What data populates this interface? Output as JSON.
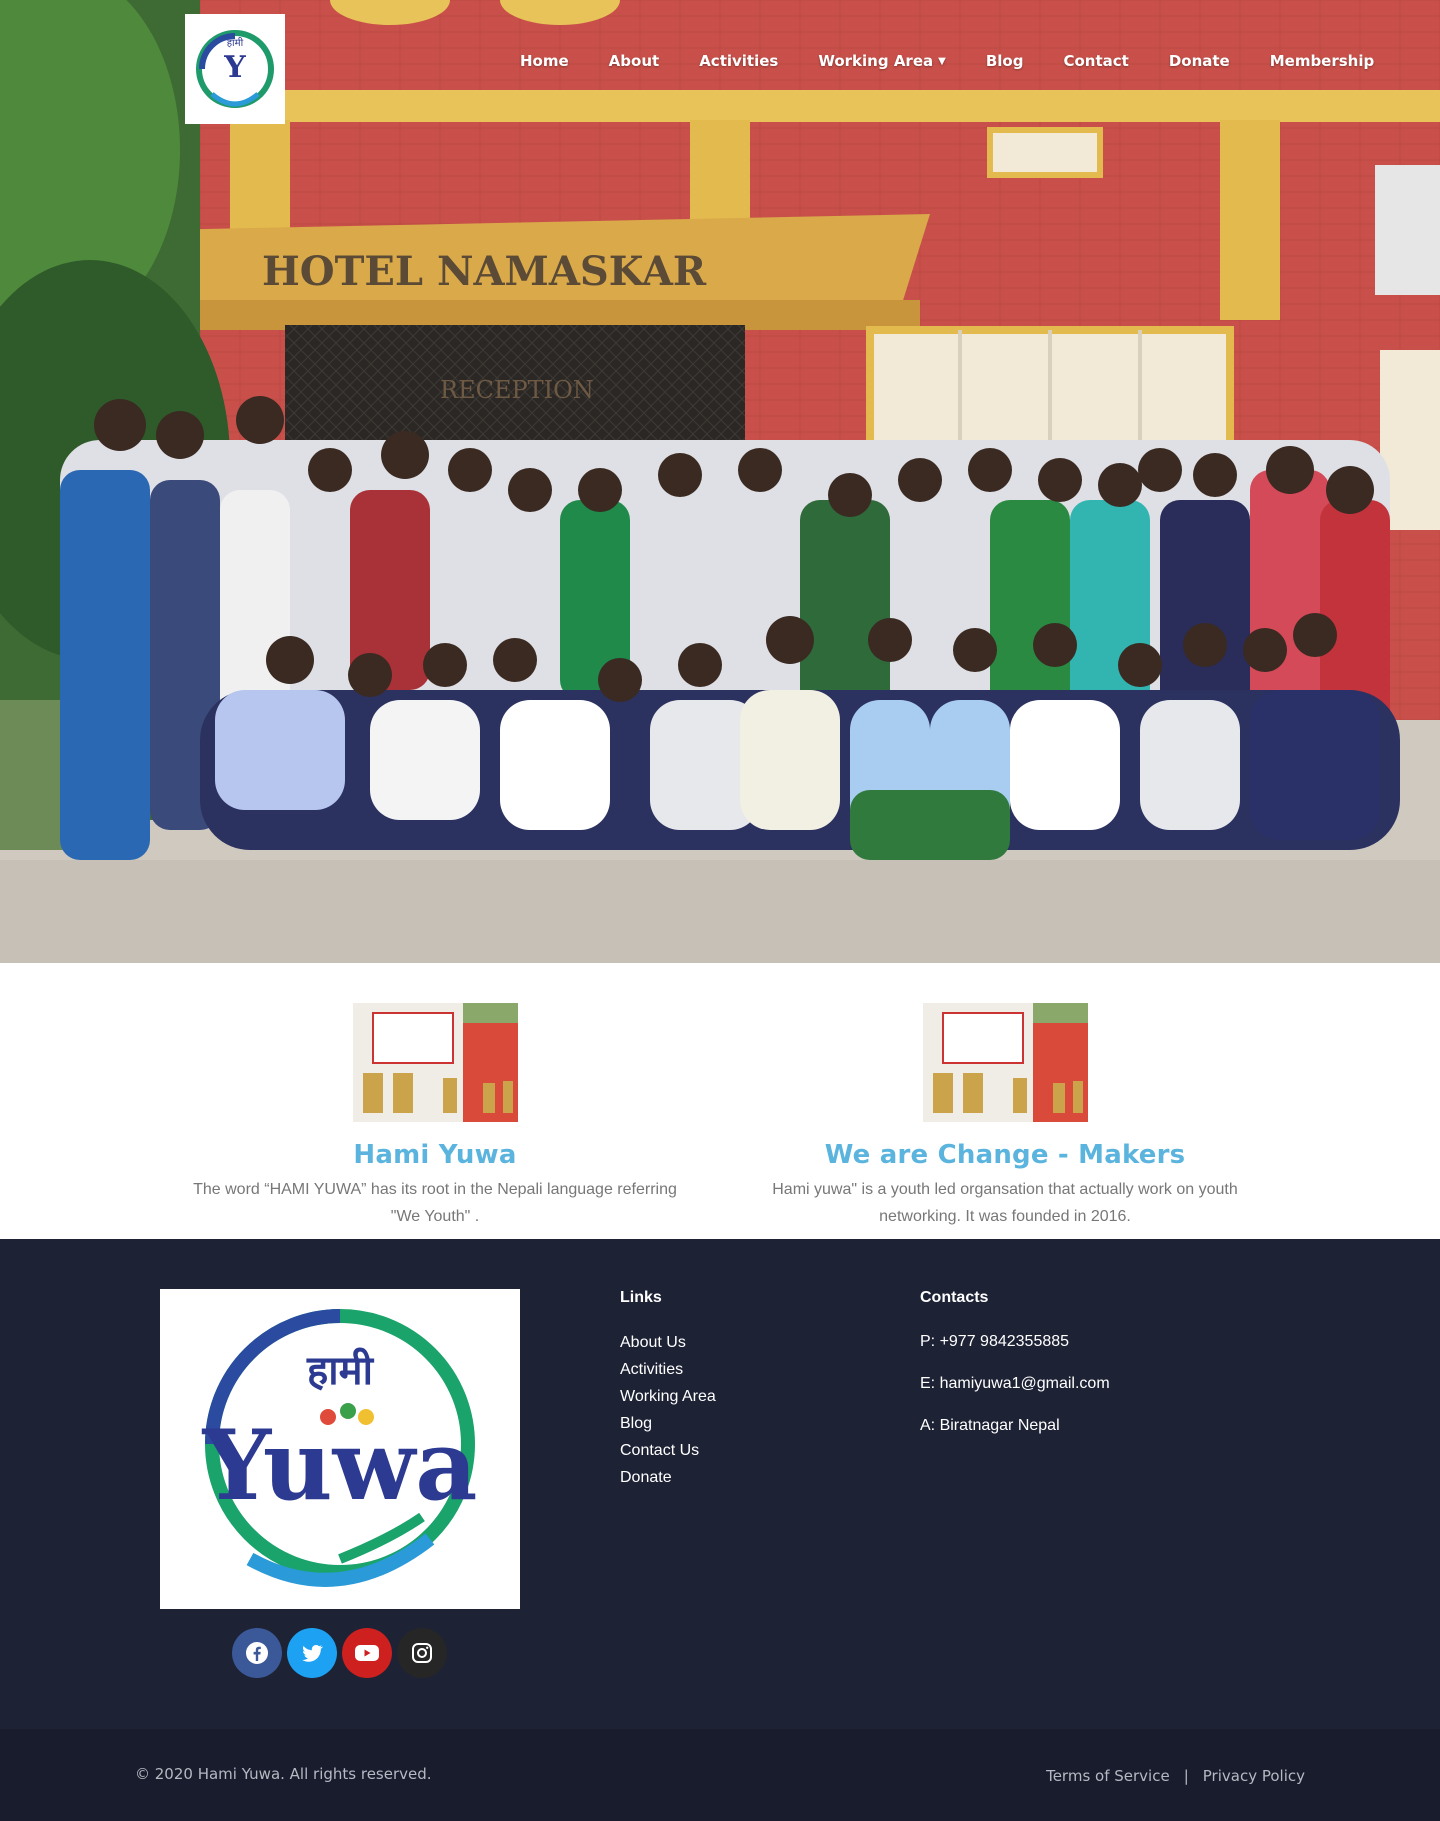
{
  "brand": {
    "logo_top": "हामी",
    "logo_main": "Yuwa"
  },
  "nav": {
    "items": [
      {
        "label": "Home"
      },
      {
        "label": "About"
      },
      {
        "label": "Activities"
      },
      {
        "label": "Working Area",
        "has_dropdown": true
      },
      {
        "label": "Blog"
      },
      {
        "label": "Contact"
      },
      {
        "label": "Donate"
      },
      {
        "label": "Membership"
      }
    ]
  },
  "hero": {
    "signboard": "HOTEL NAMASKAR",
    "door_sign": "RECEPTION"
  },
  "features": [
    {
      "title": "Hami Yuwa",
      "text": "The word “HAMI YUWA” has its root in the Nepali language referring \"We Youth\" ."
    },
    {
      "title": "We are Change - Makers",
      "text": "Hami yuwa\" is a youth led organsation that actually work on youth networking. It was founded in 2016."
    }
  ],
  "footer": {
    "links_title": "Links",
    "links": [
      "About Us",
      "Activities",
      "Working Area",
      "Blog",
      "Contact Us",
      "Donate"
    ],
    "contacts_title": "Contacts",
    "contacts": [
      "P: +977 9842355885",
      "E: hamiyuwa1@gmail.com",
      "A: Biratnagar Nepal"
    ],
    "social": [
      {
        "name": "facebook-icon",
        "color": "#3b5998"
      },
      {
        "name": "twitter-icon",
        "color": "#1da1f2"
      },
      {
        "name": "youtube-icon",
        "color": "#cd201f"
      },
      {
        "name": "instagram-icon",
        "color": "#262626"
      }
    ]
  },
  "bottom": {
    "copyright": "© 2020 Hami Yuwa. All rights reserved.",
    "terms": "Terms of Service",
    "separator": "|",
    "privacy": "Privacy Policy"
  },
  "colors": {
    "accent": "#5ab4de",
    "footer_bg": "#1e2235",
    "bottom_bg": "#181c2d"
  }
}
